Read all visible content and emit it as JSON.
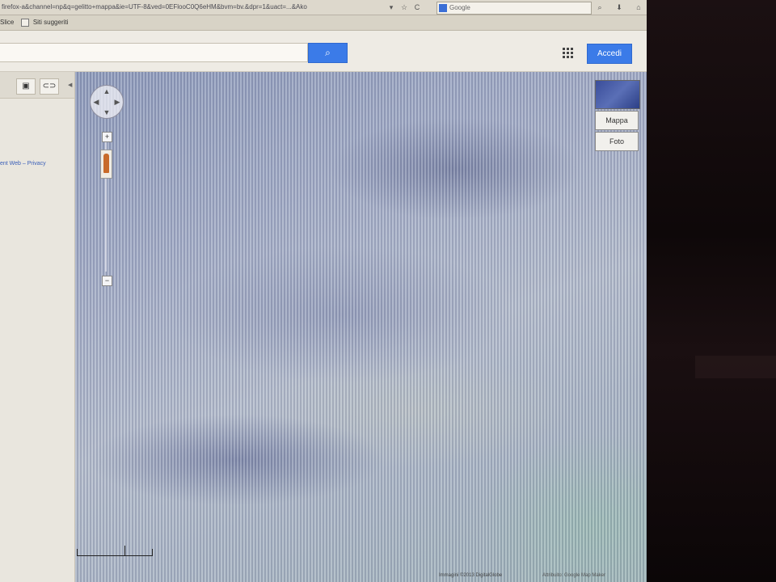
{
  "browser": {
    "url": "firefox-a&channel=np&q=gelitto+mappa&ie=UTF-8&ved=0EFlooC0Q6eHM&bvm=bv.&dpr=1&uact=...&Ako",
    "reload_glyph": "C",
    "search_engine_label": "Google",
    "bookmarks": {
      "item1": "Slice",
      "item2": "Siti suggeriti"
    }
  },
  "google_bar": {
    "search_value": "",
    "search_icon": "search-icon",
    "apps_icon": "apps-grid-icon",
    "login_label": "Accedi"
  },
  "left_panel": {
    "print_icon": "print-icon",
    "link_icon": "link-icon",
    "sidebar_link": "ent Web – Privacy"
  },
  "map": {
    "map_type_thumbnail_icon": "satellite-thumbnail-icon",
    "map_type_buttons": [
      "Mappa",
      "Foto"
    ],
    "credit": "Immagini ©2013 DigitalGlobe",
    "terms": "Attribuito: Google Map Maker"
  },
  "colors": {
    "accent_blue": "#3b7be8",
    "map_base": "#a2acc6"
  }
}
